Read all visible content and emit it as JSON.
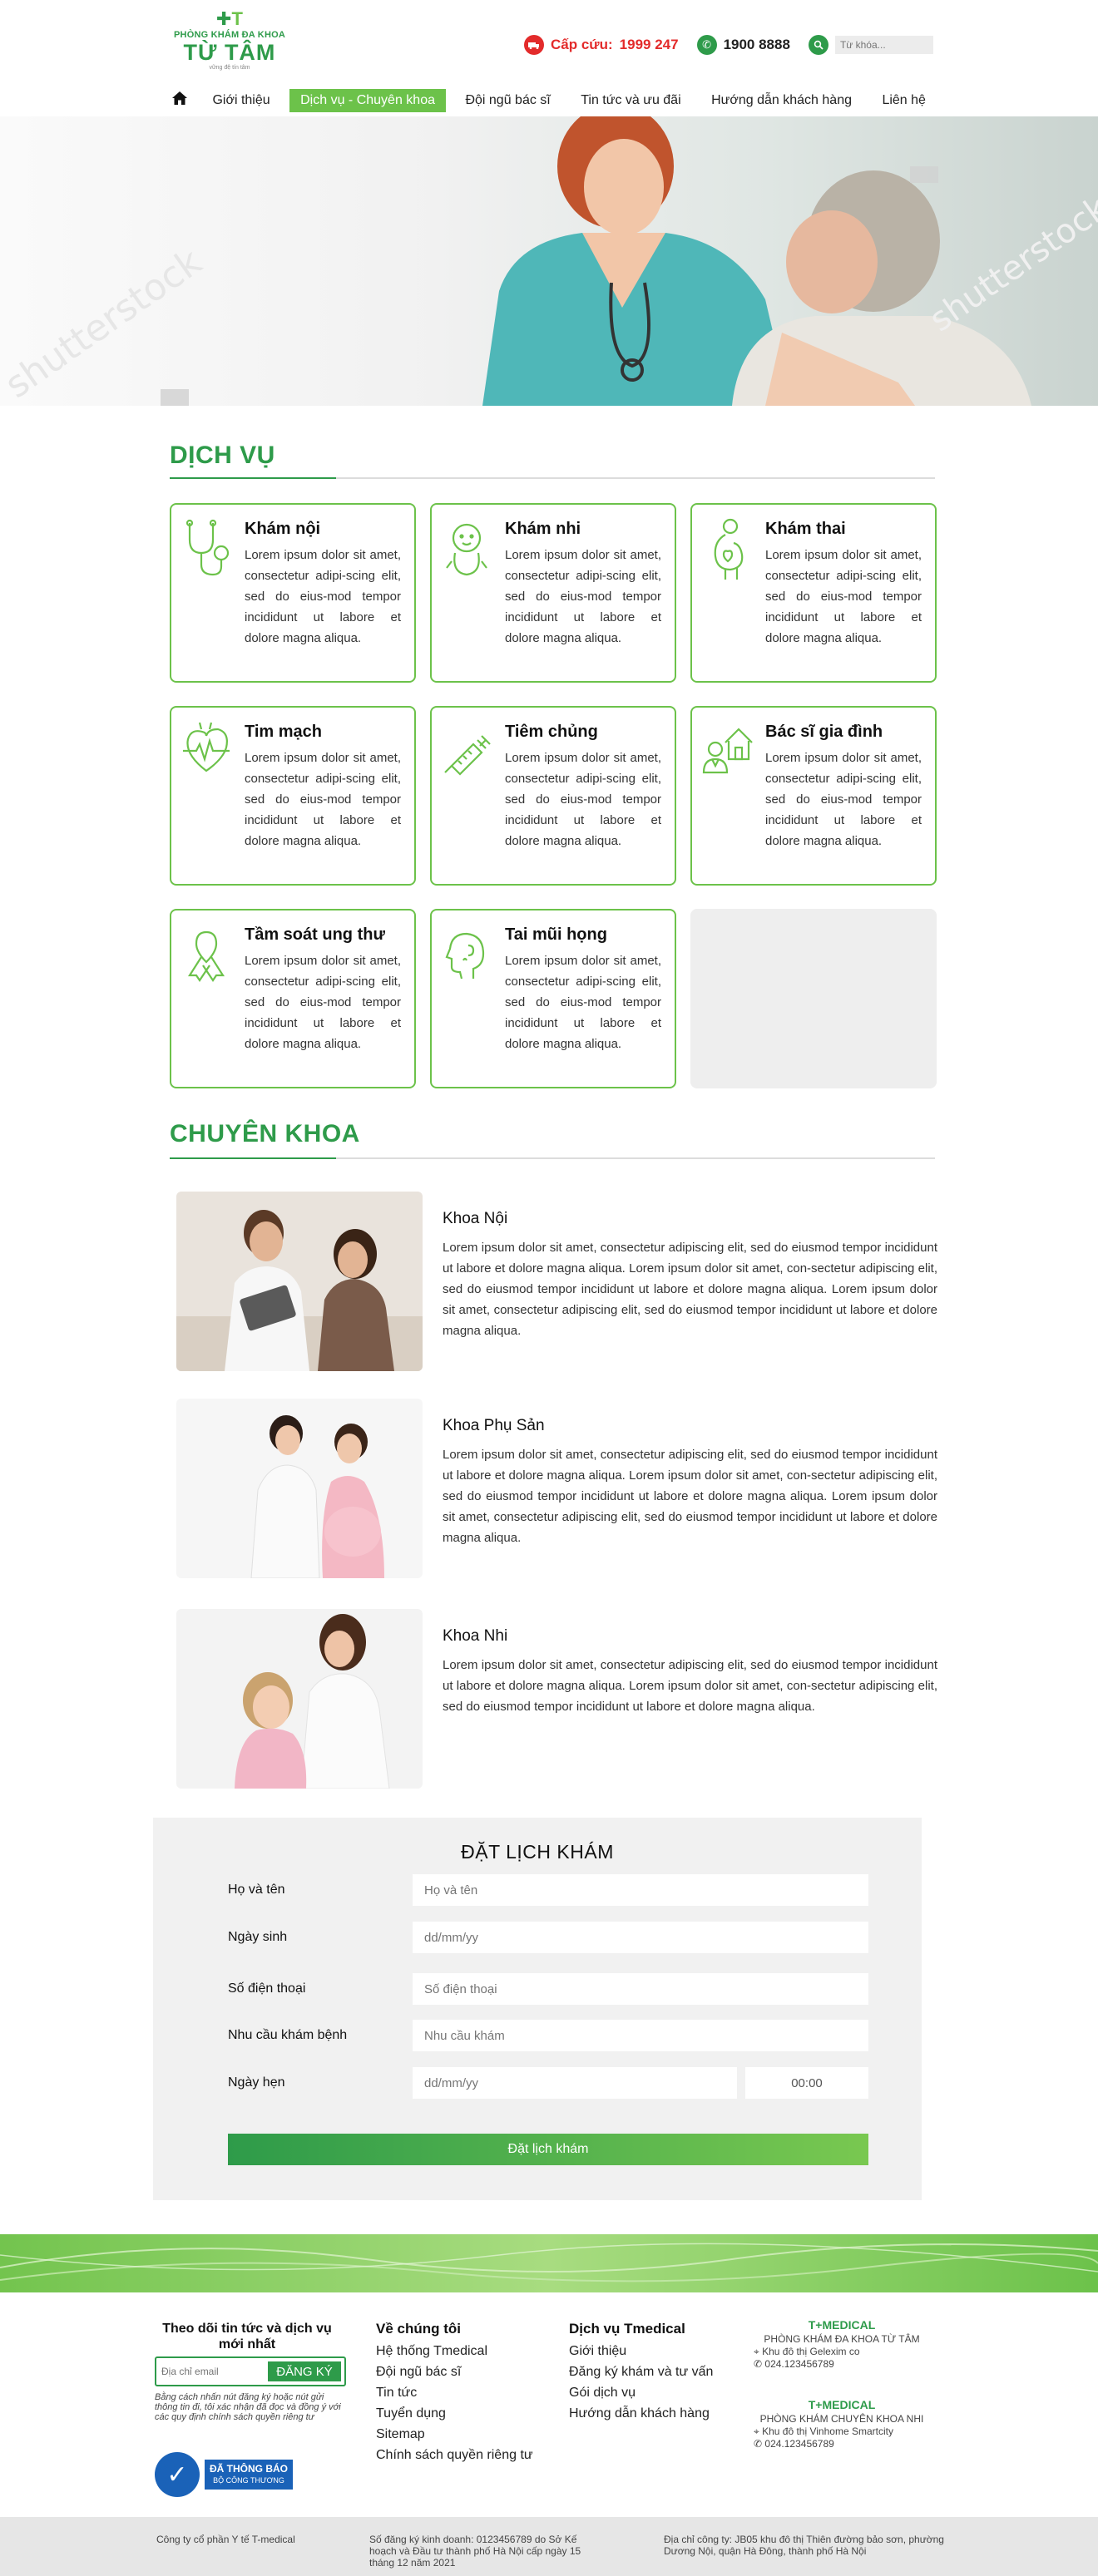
{
  "header": {
    "logo": {
      "mark": "T",
      "line1": "PHÒNG KHÁM ĐA KHOA",
      "line2": "TỪ TÂM",
      "line3": "vững đệ tín tâm"
    },
    "emergency_label": "Cấp cứu:",
    "emergency_number": "1999 247",
    "hotline": "1900 8888",
    "search_placeholder": "Từ khóa..."
  },
  "nav": {
    "items": [
      {
        "label": "Giới thiệu"
      },
      {
        "label": "Dịch vụ - Chuyên khoa"
      },
      {
        "label": "Đội ngũ bác sĩ"
      },
      {
        "label": "Tin tức và ưu đãi"
      },
      {
        "label": "Hướng dẫn khách hàng"
      },
      {
        "label": "Liên hệ"
      }
    ]
  },
  "services": {
    "title": "DỊCH VỤ",
    "items": [
      {
        "title": "Khám nội",
        "desc": "Lorem ipsum dolor sit amet, consectetur adipi-scing elit, sed do eius-mod tempor incididunt ut labore et dolore magna aliqua.",
        "icon": "stethoscope-icon"
      },
      {
        "title": "Khám nhi",
        "desc": "Lorem ipsum dolor sit amet, consectetur adipi-scing elit, sed do eius-mod tempor incididunt ut labore et dolore magna aliqua.",
        "icon": "baby-icon"
      },
      {
        "title": "Khám thai",
        "desc": "Lorem ipsum dolor sit amet, consectetur adipi-scing elit, sed do eius-mod tempor incididunt ut labore et dolore magna aliqua.",
        "icon": "pregnancy-icon"
      },
      {
        "title": "Tim mạch",
        "desc": "Lorem ipsum dolor sit amet, consectetur adipi-scing elit, sed do eius-mod tempor incididunt ut labore et dolore magna aliqua.",
        "icon": "heart-icon"
      },
      {
        "title": "Tiêm chủng",
        "desc": "Lorem ipsum dolor sit amet, consectetur adipi-scing elit, sed do eius-mod tempor incididunt ut labore et dolore magna aliqua.",
        "icon": "syringe-icon"
      },
      {
        "title": "Bác sĩ gia đình",
        "desc": "Lorem ipsum dolor sit amet, consectetur adipi-scing elit, sed do eius-mod tempor incididunt ut labore et dolore magna aliqua.",
        "icon": "family-doctor-icon"
      },
      {
        "title": "Tầm soát ung thư",
        "desc": "Lorem ipsum dolor sit amet, consectetur adipi-scing elit, sed do eius-mod tempor incididunt ut labore et dolore magna aliqua.",
        "icon": "ribbon-icon"
      },
      {
        "title": "Tai mũi họng",
        "desc": "Lorem ipsum dolor sit amet, consectetur adipi-scing elit, sed do eius-mod tempor incididunt ut labore et dolore magna aliqua.",
        "icon": "ent-icon"
      }
    ]
  },
  "specialties": {
    "title": "CHUYÊN KHOA",
    "items": [
      {
        "name": "Khoa Nội",
        "desc": "Lorem ipsum dolor sit amet, consectetur adipiscing elit, sed do eiusmod tempor incididunt ut labore et dolore magna aliqua. Lorem ipsum dolor sit amet, con-sectetur adipiscing elit, sed do eiusmod tempor incididunt ut labore et dolore magna aliqua. Lorem ipsum dolor sit amet, consectetur adipiscing elit, sed do eiusmod tempor incididunt ut labore et dolore magna aliqua."
      },
      {
        "name": "Khoa Phụ Sản",
        "desc": "Lorem ipsum dolor sit amet, consectetur adipiscing elit, sed do eiusmod tempor incididunt ut labore et dolore magna aliqua. Lorem ipsum dolor sit amet, con-sectetur adipiscing elit, sed do eiusmod tempor incididunt ut labore et dolore magna aliqua. Lorem ipsum dolor sit amet, consectetur adipiscing elit, sed do eiusmod tempor incididunt ut labore et dolore magna aliqua."
      },
      {
        "name": "Khoa Nhi",
        "desc": "Lorem ipsum dolor sit amet, consectetur adipiscing elit, sed do eiusmod tempor incididunt ut labore et dolore magna aliqua. Lorem ipsum dolor sit amet, con-sectetur adipiscing elit, sed do eiusmod tempor incididunt ut labore et dolore magna aliqua."
      }
    ]
  },
  "booking": {
    "title": "ĐẶT LỊCH KHÁM",
    "fields": {
      "name_label": "Họ và tên",
      "name_placeholder": "Họ và tên",
      "dob_label": "Ngày sinh",
      "dob_placeholder": "dd/mm/yy",
      "phone_label": "Số điện thoại",
      "phone_placeholder": "Số điện thoại",
      "need_label": "Nhu cầu khám bệnh",
      "need_placeholder": "Nhu cầu khám",
      "appt_label": "Ngày hẹn",
      "appt_date_placeholder": "dd/mm/yy",
      "appt_time_value": "00:00"
    },
    "submit_label": "Đặt lịch khám"
  },
  "footer": {
    "newsletter": {
      "title": "Theo dõi tin tức và dịch vụ mới nhất",
      "placeholder": "Địa chỉ email",
      "button": "ĐĂNG KÝ",
      "note": "Bằng cách nhấn nút đăng ký hoặc nút gửi thông tin đi, tôi xác nhận đã đọc và đồng ý với các quy định chính sách quyền riêng tư"
    },
    "badge": {
      "line1": "ĐÃ THÔNG BÁO",
      "line2": "BỘ CÔNG THƯƠNG"
    },
    "about": {
      "title": "Về chúng tôi",
      "links": [
        "Hệ thống Tmedical",
        "Đội ngũ bác sĩ",
        "Tin tức",
        "Tuyển dụng",
        "Sitemap",
        "Chính sách quyền riêng tư"
      ]
    },
    "services": {
      "title": "Dịch vụ Tmedical",
      "links": [
        "Giới thiệu",
        "Đăng ký khám và tư vấn",
        "Gói dịch vụ",
        "Hướng dẫn khách hàng"
      ]
    },
    "branches": [
      {
        "logo": "T+MEDICAL",
        "name": "PHÒNG KHÁM ĐA KHOA TỪ TÂM",
        "address": "Khu đô thị Gelexim co",
        "phone": "024.123456789"
      },
      {
        "logo": "T+MEDICAL",
        "name": "PHÒNG KHÁM CHUYÊN KHOA NHI",
        "address": "Khu đô thị Vinhome Smartcity",
        "phone": "024.123456789"
      }
    ],
    "bottom": {
      "company": "Công ty cổ phần Y tế T-medical",
      "license": "Số đăng ký kinh doanh: 0123456789 do Sở Kế hoạch và Đầu tư thành phố Hà Nội cấp ngày 15 tháng 12 năm 2021",
      "address": "Địa chỉ công ty: JB05 khu đô thị Thiên đường bảo sơn, phường Dương Nội, quận Hà Đông, thành phố Hà Nội"
    }
  }
}
